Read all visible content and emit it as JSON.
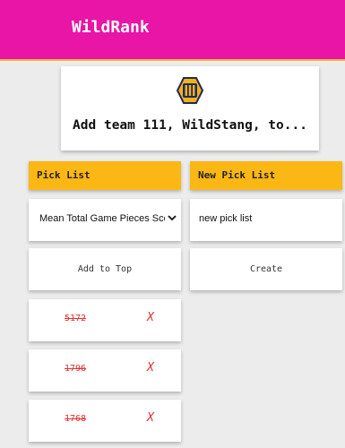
{
  "header": {
    "app_title": "WildRank",
    "background_color": "#e815a6",
    "accent_color": "#f0b73a"
  },
  "team_card": {
    "title": "Add team 111, WildStang, to...",
    "logo_icon": "wildstang-logo-icon"
  },
  "pick_list": {
    "header": "Pick List",
    "header_color": "#fbb714",
    "selected_list": "Mean Total Game Pieces Scored",
    "add_button": "Add to Top",
    "teams": [
      {
        "number": "5172",
        "remove": "X"
      },
      {
        "number": "1796",
        "remove": "X"
      },
      {
        "number": "1768",
        "remove": "X"
      }
    ],
    "strike_color": "#e03030"
  },
  "new_pick_list": {
    "header": "New Pick List",
    "name_value": "new pick list",
    "create_button": "Create"
  }
}
